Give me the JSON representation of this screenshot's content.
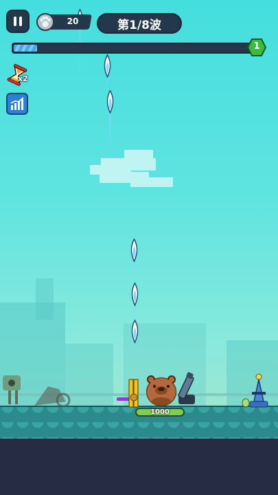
{
  "hud": {
    "coins": "20",
    "wave_text": "第1/8波",
    "wave_progress": 0.1,
    "level": "1",
    "speed_multiplier": "x2"
  },
  "player": {
    "hp": "1000"
  },
  "icons": {
    "pause": "pause-icon",
    "coin": "paw-coin-icon",
    "speed": "hourglass-icon",
    "stats": "bar-chart-icon"
  },
  "colors": {
    "sky": "#44dede",
    "hud_dark": "#23384a",
    "progress_fill": "#4aa8e8",
    "level_badge": "#3dbb3d",
    "hp_green": "#7ecf4e"
  }
}
